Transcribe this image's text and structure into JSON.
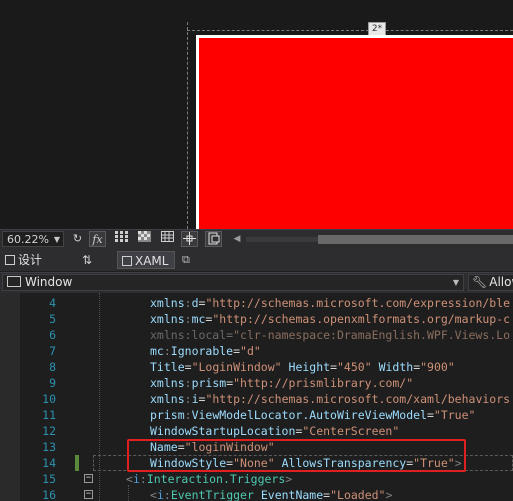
{
  "designer": {
    "ruler_badge": "2*",
    "colors": {
      "canvas": "#1a1a1a",
      "window_background": "#ff0000",
      "window_frame": "#ffffff"
    }
  },
  "zoom_toolbar": {
    "zoom_value": "60.22%",
    "buttons": [
      "refresh-icon",
      "fx-icon",
      "grid-icon",
      "checker-icon",
      "snap-grid-icon",
      "snap-lines-icon",
      "device-icon"
    ],
    "fx_label": "fx"
  },
  "tabs": {
    "design_label": "设计",
    "swap_label": "⇅",
    "xaml_label": "XAML",
    "popout_label": "⧉"
  },
  "selector": {
    "element_label": "Window",
    "member_label": "Allow"
  },
  "editor": {
    "highlight_color": "#e02020",
    "lines": [
      {
        "num": "4",
        "segs": [
          [
            "tk-attr",
            "xmlns"
          ],
          [
            "tk-punct",
            ":"
          ],
          [
            "tk-attr",
            "d"
          ],
          [
            "tk-eq",
            "="
          ],
          [
            "tk-str",
            "\"http://schemas.microsoft.com/expression/ble"
          ]
        ]
      },
      {
        "num": "5",
        "segs": [
          [
            "tk-attr",
            "xmlns"
          ],
          [
            "tk-punct",
            ":"
          ],
          [
            "tk-attr",
            "mc"
          ],
          [
            "tk-eq",
            "="
          ],
          [
            "tk-str",
            "\"http://schemas.openxmlformats.org/markup-c"
          ]
        ]
      },
      {
        "num": "6",
        "segs": [
          [
            "tk-dim",
            "xmlns:local"
          ],
          [
            "tk-dim",
            "="
          ],
          [
            "tk-dimstr",
            "\"clr-namespace:DramaEnglish.WPF.Views.Lo"
          ]
        ]
      },
      {
        "num": "7",
        "segs": [
          [
            "tk-attr",
            "mc"
          ],
          [
            "tk-punct",
            ":"
          ],
          [
            "tk-attr",
            "Ignorable"
          ],
          [
            "tk-eq",
            "="
          ],
          [
            "tk-str",
            "\"d\""
          ]
        ]
      },
      {
        "num": "8",
        "segs": [
          [
            "tk-attr",
            "Title"
          ],
          [
            "tk-eq",
            "="
          ],
          [
            "tk-str",
            "\"LoginWindow\""
          ],
          [
            "tk-eq",
            " "
          ],
          [
            "tk-attr",
            "Height"
          ],
          [
            "tk-eq",
            "="
          ],
          [
            "tk-str",
            "\"450\""
          ],
          [
            "tk-eq",
            " "
          ],
          [
            "tk-attr",
            "Width"
          ],
          [
            "tk-eq",
            "="
          ],
          [
            "tk-str",
            "\"900\""
          ]
        ]
      },
      {
        "num": "9",
        "segs": [
          [
            "tk-attr",
            "xmlns"
          ],
          [
            "tk-punct",
            ":"
          ],
          [
            "tk-attr",
            "prism"
          ],
          [
            "tk-eq",
            "="
          ],
          [
            "tk-str",
            "\"http://prismlibrary.com/\""
          ]
        ]
      },
      {
        "num": "10",
        "segs": [
          [
            "tk-attr",
            "xmlns"
          ],
          [
            "tk-punct",
            ":"
          ],
          [
            "tk-attr",
            "i"
          ],
          [
            "tk-eq",
            "="
          ],
          [
            "tk-str",
            "\"http://schemas.microsoft.com/xaml/behaviors"
          ]
        ]
      },
      {
        "num": "11",
        "segs": [
          [
            "tk-attr",
            "prism"
          ],
          [
            "tk-punct",
            ":"
          ],
          [
            "tk-attr",
            "ViewModelLocator.AutoWireViewModel"
          ],
          [
            "tk-eq",
            "="
          ],
          [
            "tk-str",
            "\"True\""
          ]
        ]
      },
      {
        "num": "12",
        "segs": [
          [
            "tk-attr",
            "WindowStartupLocation"
          ],
          [
            "tk-eq",
            "="
          ],
          [
            "tk-str",
            "\"CenterScreen\""
          ]
        ]
      },
      {
        "num": "13",
        "segs": [
          [
            "tk-attr",
            "Name"
          ],
          [
            "tk-eq",
            "="
          ],
          [
            "tk-str",
            "\"loginWindow\""
          ]
        ]
      },
      {
        "num": "14",
        "segs": [
          [
            "tk-attr",
            "WindowStyle"
          ],
          [
            "tk-eq",
            "="
          ],
          [
            "tk-str",
            "\"None\""
          ],
          [
            "tk-eq",
            " "
          ],
          [
            "tk-attr",
            "AllowsTransparency"
          ],
          [
            "tk-eq",
            "="
          ],
          [
            "tk-str",
            "\"True\""
          ],
          [
            "tk-punct",
            ">"
          ]
        ]
      },
      {
        "num": "15",
        "segs": [
          [
            "tk-punct",
            "<"
          ],
          [
            "tk-ns",
            "i"
          ],
          [
            "tk-punct",
            ":"
          ],
          [
            "tk-elem",
            "Interaction.Triggers"
          ],
          [
            "tk-punct",
            ">"
          ]
        ]
      },
      {
        "num": "16",
        "segs": [
          [
            "tk-punct",
            "<"
          ],
          [
            "tk-ns",
            "i"
          ],
          [
            "tk-punct",
            ":"
          ],
          [
            "tk-elem",
            "EventTrigger"
          ],
          [
            "tk-eq",
            " "
          ],
          [
            "tk-attr",
            "EventName"
          ],
          [
            "tk-eq",
            "="
          ],
          [
            "tk-str",
            "\"Loaded\""
          ],
          [
            "tk-punct",
            ">"
          ]
        ]
      }
    ]
  }
}
